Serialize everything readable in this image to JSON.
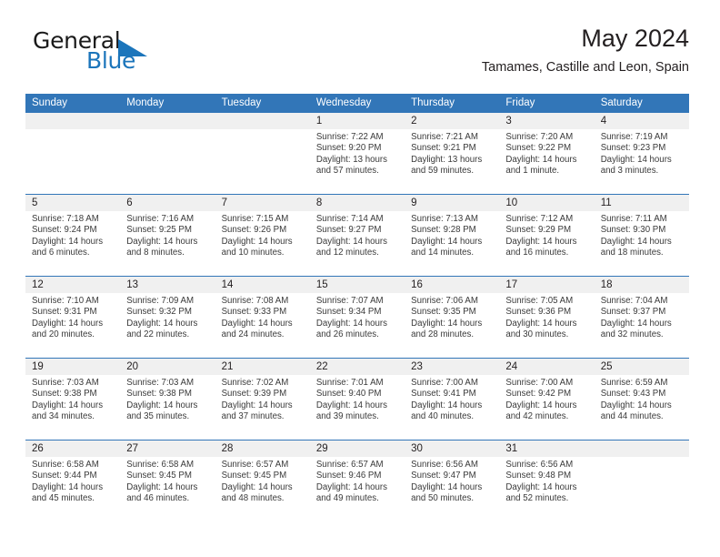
{
  "brand": {
    "word_one": "General",
    "word_two": "Blue",
    "flag_icon": "blue-triangle-flag-icon",
    "accent_color": "#1b75bb"
  },
  "header": {
    "title": "May 2024",
    "subtitle": "Tamames, Castille and Leon, Spain"
  },
  "theme": {
    "header_blue": "#3276b8",
    "day_bar_gray": "#f0f0f0"
  },
  "calendar": {
    "weekdays": [
      "Sunday",
      "Monday",
      "Tuesday",
      "Wednesday",
      "Thursday",
      "Friday",
      "Saturday"
    ],
    "weeks": [
      [
        {
          "day": "",
          "empty": true
        },
        {
          "day": "",
          "empty": true
        },
        {
          "day": "",
          "empty": true
        },
        {
          "day": "1",
          "sunrise": "Sunrise: 7:22 AM",
          "sunset": "Sunset: 9:20 PM",
          "daylight": "Daylight: 13 hours and 57 minutes."
        },
        {
          "day": "2",
          "sunrise": "Sunrise: 7:21 AM",
          "sunset": "Sunset: 9:21 PM",
          "daylight": "Daylight: 13 hours and 59 minutes."
        },
        {
          "day": "3",
          "sunrise": "Sunrise: 7:20 AM",
          "sunset": "Sunset: 9:22 PM",
          "daylight": "Daylight: 14 hours and 1 minute."
        },
        {
          "day": "4",
          "sunrise": "Sunrise: 7:19 AM",
          "sunset": "Sunset: 9:23 PM",
          "daylight": "Daylight: 14 hours and 3 minutes."
        }
      ],
      [
        {
          "day": "5",
          "sunrise": "Sunrise: 7:18 AM",
          "sunset": "Sunset: 9:24 PM",
          "daylight": "Daylight: 14 hours and 6 minutes."
        },
        {
          "day": "6",
          "sunrise": "Sunrise: 7:16 AM",
          "sunset": "Sunset: 9:25 PM",
          "daylight": "Daylight: 14 hours and 8 minutes."
        },
        {
          "day": "7",
          "sunrise": "Sunrise: 7:15 AM",
          "sunset": "Sunset: 9:26 PM",
          "daylight": "Daylight: 14 hours and 10 minutes."
        },
        {
          "day": "8",
          "sunrise": "Sunrise: 7:14 AM",
          "sunset": "Sunset: 9:27 PM",
          "daylight": "Daylight: 14 hours and 12 minutes."
        },
        {
          "day": "9",
          "sunrise": "Sunrise: 7:13 AM",
          "sunset": "Sunset: 9:28 PM",
          "daylight": "Daylight: 14 hours and 14 minutes."
        },
        {
          "day": "10",
          "sunrise": "Sunrise: 7:12 AM",
          "sunset": "Sunset: 9:29 PM",
          "daylight": "Daylight: 14 hours and 16 minutes."
        },
        {
          "day": "11",
          "sunrise": "Sunrise: 7:11 AM",
          "sunset": "Sunset: 9:30 PM",
          "daylight": "Daylight: 14 hours and 18 minutes."
        }
      ],
      [
        {
          "day": "12",
          "sunrise": "Sunrise: 7:10 AM",
          "sunset": "Sunset: 9:31 PM",
          "daylight": "Daylight: 14 hours and 20 minutes."
        },
        {
          "day": "13",
          "sunrise": "Sunrise: 7:09 AM",
          "sunset": "Sunset: 9:32 PM",
          "daylight": "Daylight: 14 hours and 22 minutes."
        },
        {
          "day": "14",
          "sunrise": "Sunrise: 7:08 AM",
          "sunset": "Sunset: 9:33 PM",
          "daylight": "Daylight: 14 hours and 24 minutes."
        },
        {
          "day": "15",
          "sunrise": "Sunrise: 7:07 AM",
          "sunset": "Sunset: 9:34 PM",
          "daylight": "Daylight: 14 hours and 26 minutes."
        },
        {
          "day": "16",
          "sunrise": "Sunrise: 7:06 AM",
          "sunset": "Sunset: 9:35 PM",
          "daylight": "Daylight: 14 hours and 28 minutes."
        },
        {
          "day": "17",
          "sunrise": "Sunrise: 7:05 AM",
          "sunset": "Sunset: 9:36 PM",
          "daylight": "Daylight: 14 hours and 30 minutes."
        },
        {
          "day": "18",
          "sunrise": "Sunrise: 7:04 AM",
          "sunset": "Sunset: 9:37 PM",
          "daylight": "Daylight: 14 hours and 32 minutes."
        }
      ],
      [
        {
          "day": "19",
          "sunrise": "Sunrise: 7:03 AM",
          "sunset": "Sunset: 9:38 PM",
          "daylight": "Daylight: 14 hours and 34 minutes."
        },
        {
          "day": "20",
          "sunrise": "Sunrise: 7:03 AM",
          "sunset": "Sunset: 9:38 PM",
          "daylight": "Daylight: 14 hours and 35 minutes."
        },
        {
          "day": "21",
          "sunrise": "Sunrise: 7:02 AM",
          "sunset": "Sunset: 9:39 PM",
          "daylight": "Daylight: 14 hours and 37 minutes."
        },
        {
          "day": "22",
          "sunrise": "Sunrise: 7:01 AM",
          "sunset": "Sunset: 9:40 PM",
          "daylight": "Daylight: 14 hours and 39 minutes."
        },
        {
          "day": "23",
          "sunrise": "Sunrise: 7:00 AM",
          "sunset": "Sunset: 9:41 PM",
          "daylight": "Daylight: 14 hours and 40 minutes."
        },
        {
          "day": "24",
          "sunrise": "Sunrise: 7:00 AM",
          "sunset": "Sunset: 9:42 PM",
          "daylight": "Daylight: 14 hours and 42 minutes."
        },
        {
          "day": "25",
          "sunrise": "Sunrise: 6:59 AM",
          "sunset": "Sunset: 9:43 PM",
          "daylight": "Daylight: 14 hours and 44 minutes."
        }
      ],
      [
        {
          "day": "26",
          "sunrise": "Sunrise: 6:58 AM",
          "sunset": "Sunset: 9:44 PM",
          "daylight": "Daylight: 14 hours and 45 minutes."
        },
        {
          "day": "27",
          "sunrise": "Sunrise: 6:58 AM",
          "sunset": "Sunset: 9:45 PM",
          "daylight": "Daylight: 14 hours and 46 minutes."
        },
        {
          "day": "28",
          "sunrise": "Sunrise: 6:57 AM",
          "sunset": "Sunset: 9:45 PM",
          "daylight": "Daylight: 14 hours and 48 minutes."
        },
        {
          "day": "29",
          "sunrise": "Sunrise: 6:57 AM",
          "sunset": "Sunset: 9:46 PM",
          "daylight": "Daylight: 14 hours and 49 minutes."
        },
        {
          "day": "30",
          "sunrise": "Sunrise: 6:56 AM",
          "sunset": "Sunset: 9:47 PM",
          "daylight": "Daylight: 14 hours and 50 minutes."
        },
        {
          "day": "31",
          "sunrise": "Sunrise: 6:56 AM",
          "sunset": "Sunset: 9:48 PM",
          "daylight": "Daylight: 14 hours and 52 minutes."
        },
        {
          "day": "",
          "empty": true
        }
      ]
    ]
  }
}
